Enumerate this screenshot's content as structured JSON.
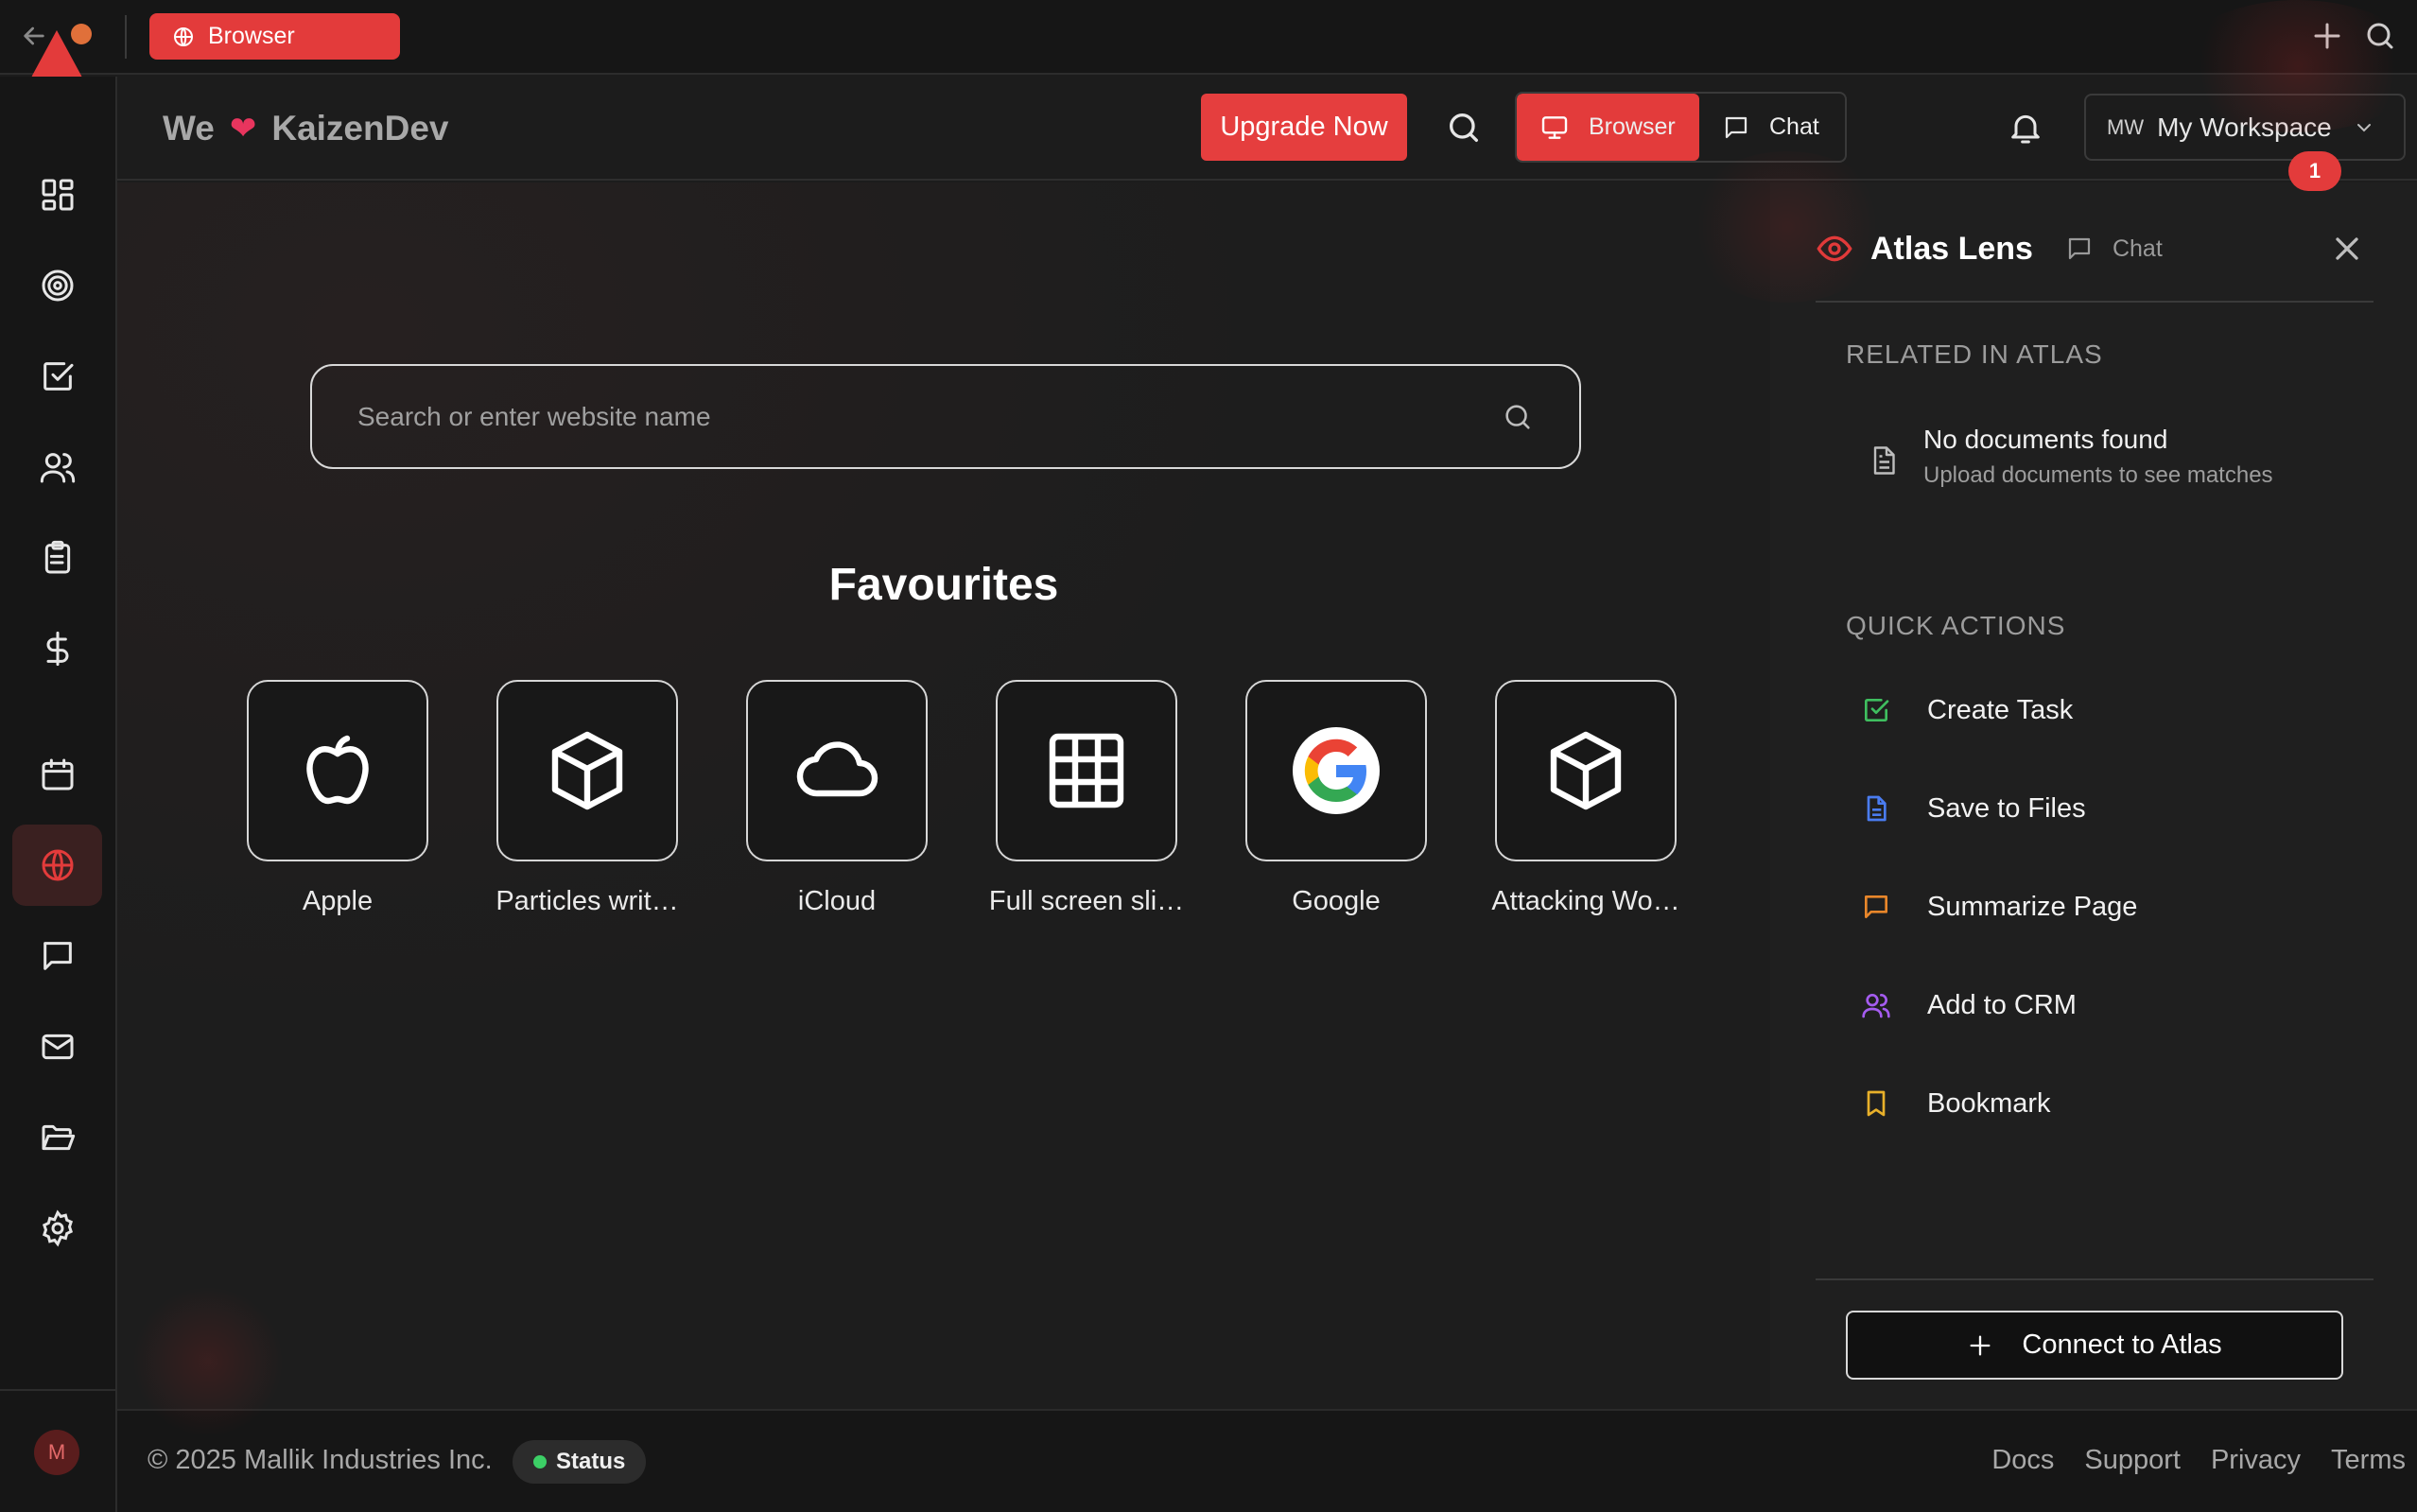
{
  "tabbar": {
    "active_tab_label": "Browser"
  },
  "header": {
    "brand_prefix": "We",
    "brand_name": "KaizenDev",
    "upgrade_label": "Upgrade Now",
    "mode_browser_label": "Browser",
    "mode_chat_label": "Chat",
    "workspace_initials": "MW",
    "workspace_label": "My Workspace"
  },
  "sidebar": {
    "items": [
      {
        "name": "dashboard-icon",
        "active": false
      },
      {
        "name": "target-icon",
        "active": false
      },
      {
        "name": "checkbox-icon",
        "active": false
      },
      {
        "name": "users-icon",
        "active": false
      },
      {
        "name": "clipboard-icon",
        "active": false
      },
      {
        "name": "dollar-icon",
        "active": false
      },
      {
        "name": "calendar-icon",
        "active": false
      },
      {
        "name": "globe-icon",
        "active": true
      },
      {
        "name": "chat-icon",
        "active": false
      },
      {
        "name": "mail-icon",
        "active": false
      },
      {
        "name": "folder-icon",
        "active": false
      },
      {
        "name": "settings-icon",
        "active": false
      }
    ],
    "avatar_initial": "M"
  },
  "main": {
    "search_placeholder": "Search or enter website name",
    "favourites_title": "Favourites",
    "favourites": [
      {
        "label": "Apple",
        "icon": "apple-icon"
      },
      {
        "label": "Particles writ…",
        "icon": "cube-icon"
      },
      {
        "label": "iCloud",
        "icon": "cloud-icon"
      },
      {
        "label": "Full screen sli…",
        "icon": "grid-icon"
      },
      {
        "label": "Google",
        "icon": "google-icon"
      },
      {
        "label": "Attacking Wo…",
        "icon": "cube-icon"
      }
    ]
  },
  "panel": {
    "title": "Atlas Lens",
    "chat_label": "Chat",
    "related_title": "RELATED IN ATLAS",
    "related_count": "1",
    "no_docs_title": "No documents found",
    "no_docs_subtitle": "Upload documents to see matches",
    "quick_actions_title": "QUICK ACTIONS",
    "quick_actions": [
      {
        "label": "Create Task",
        "icon": "check-square-icon",
        "color": "#3fbf5f"
      },
      {
        "label": "Save to Files",
        "icon": "file-icon",
        "color": "#4a7cf0"
      },
      {
        "label": "Summarize Page",
        "icon": "message-icon",
        "color": "#e8862a"
      },
      {
        "label": "Add to CRM",
        "icon": "users-icon",
        "color": "#a55cf0"
      },
      {
        "label": "Bookmark",
        "icon": "bookmark-icon",
        "color": "#e8b02a"
      }
    ],
    "connect_label": "Connect to Atlas"
  },
  "footer": {
    "copyright": "© 2025 Mallik Industries Inc.",
    "status_label": "Status",
    "links": [
      "Docs",
      "Support",
      "Privacy",
      "Terms"
    ]
  },
  "colors": {
    "accent": "#e33b3b",
    "background": "#1c1c1c",
    "status_ok": "#3ccf66"
  }
}
